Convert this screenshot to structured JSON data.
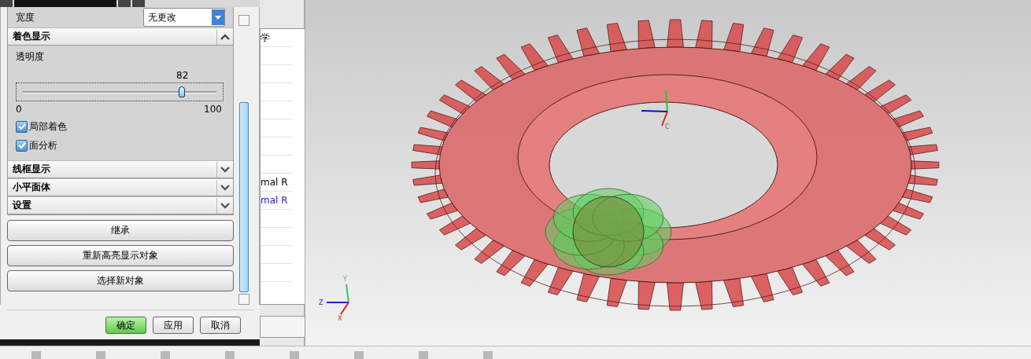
{
  "dialog": {
    "width_field": {
      "label": "宽度",
      "value": "无更改"
    },
    "sections": [
      {
        "title": "着色显示",
        "expanded": true
      },
      {
        "title": "线框显示",
        "expanded": false
      },
      {
        "title": "小平面体",
        "expanded": false
      },
      {
        "title": "设置",
        "expanded": false
      }
    ],
    "transparency": {
      "label": "透明度",
      "reading": "82",
      "level": 0.82,
      "min": "0",
      "max": "100"
    },
    "checkboxes": [
      {
        "label": "局部着色",
        "checked": true
      },
      {
        "label": "面分析",
        "checked": true
      }
    ],
    "actions": [
      "继承",
      "重新高亮显示对象",
      "选择新对象"
    ],
    "buttons": [
      {
        "label": "确定",
        "default": true
      },
      {
        "label": "应用",
        "default": false
      },
      {
        "label": "取消",
        "default": false
      }
    ]
  },
  "background_table": {
    "cells": [
      {
        "text": "学",
        "kind": "plain"
      },
      {
        "text": "mal R",
        "kind": "plain"
      },
      {
        "text": "mal R",
        "kind": "link"
      }
    ]
  },
  "viewport": {
    "work_triad_labels": [
      "Y",
      "Z",
      "X"
    ],
    "center_label": "C"
  }
}
